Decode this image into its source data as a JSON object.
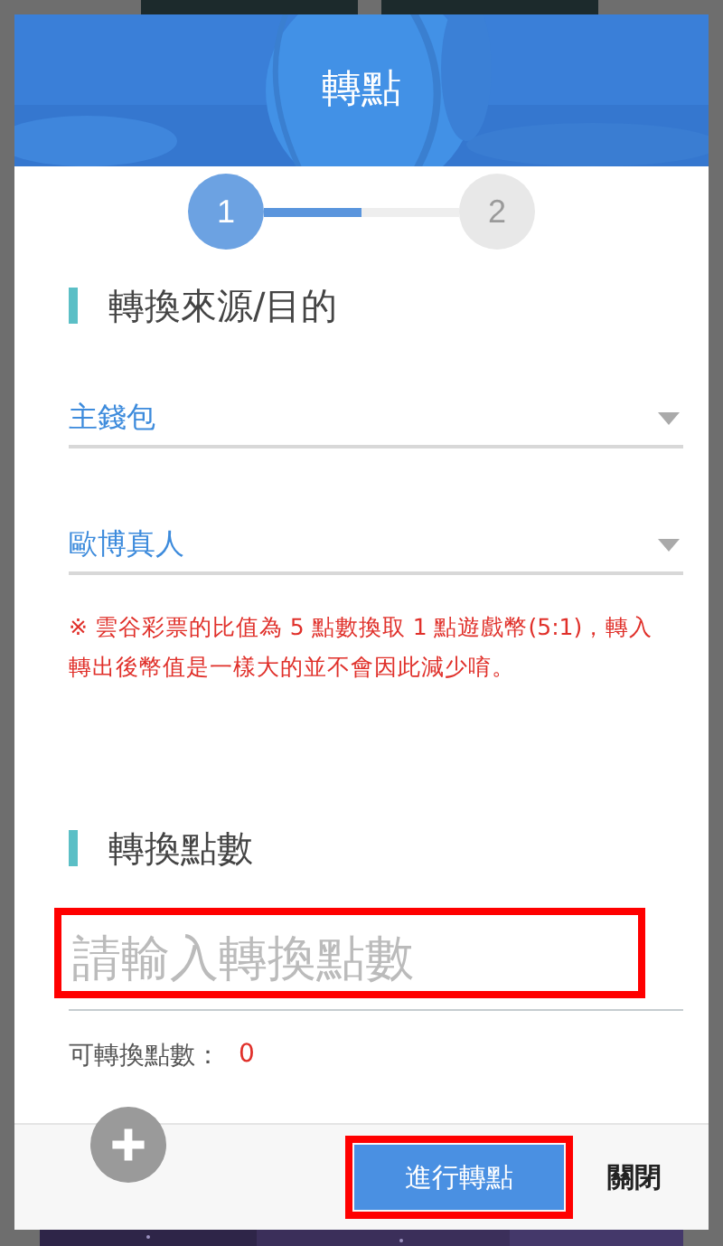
{
  "header": {
    "title": "轉點"
  },
  "steps": [
    {
      "label": "1",
      "selected": true
    },
    {
      "label": "2",
      "selected": false
    }
  ],
  "step_progress": {
    "level": 0.5
  },
  "source_section": {
    "title": "轉換來源/目的",
    "selects": [
      {
        "value": "主錢包"
      },
      {
        "value": "歐博真人"
      }
    ],
    "note": "※ 雲谷彩票的比值為 5 點數換取 1 點遊戲幣(5:1)，轉入轉出後幣值是一樣大的並不會因此減少唷。"
  },
  "points_section": {
    "title": "轉換點數",
    "input": {
      "placeholder": "請輸入轉換點數",
      "highlighted": true
    },
    "available_label": "可轉換點數：",
    "available_value": "0"
  },
  "footer": {
    "buttons": [
      {
        "label": "進行轉點",
        "kind": "primary",
        "highlighted": true
      },
      {
        "label": "關閉",
        "kind": "text",
        "highlighted": false
      }
    ]
  }
}
